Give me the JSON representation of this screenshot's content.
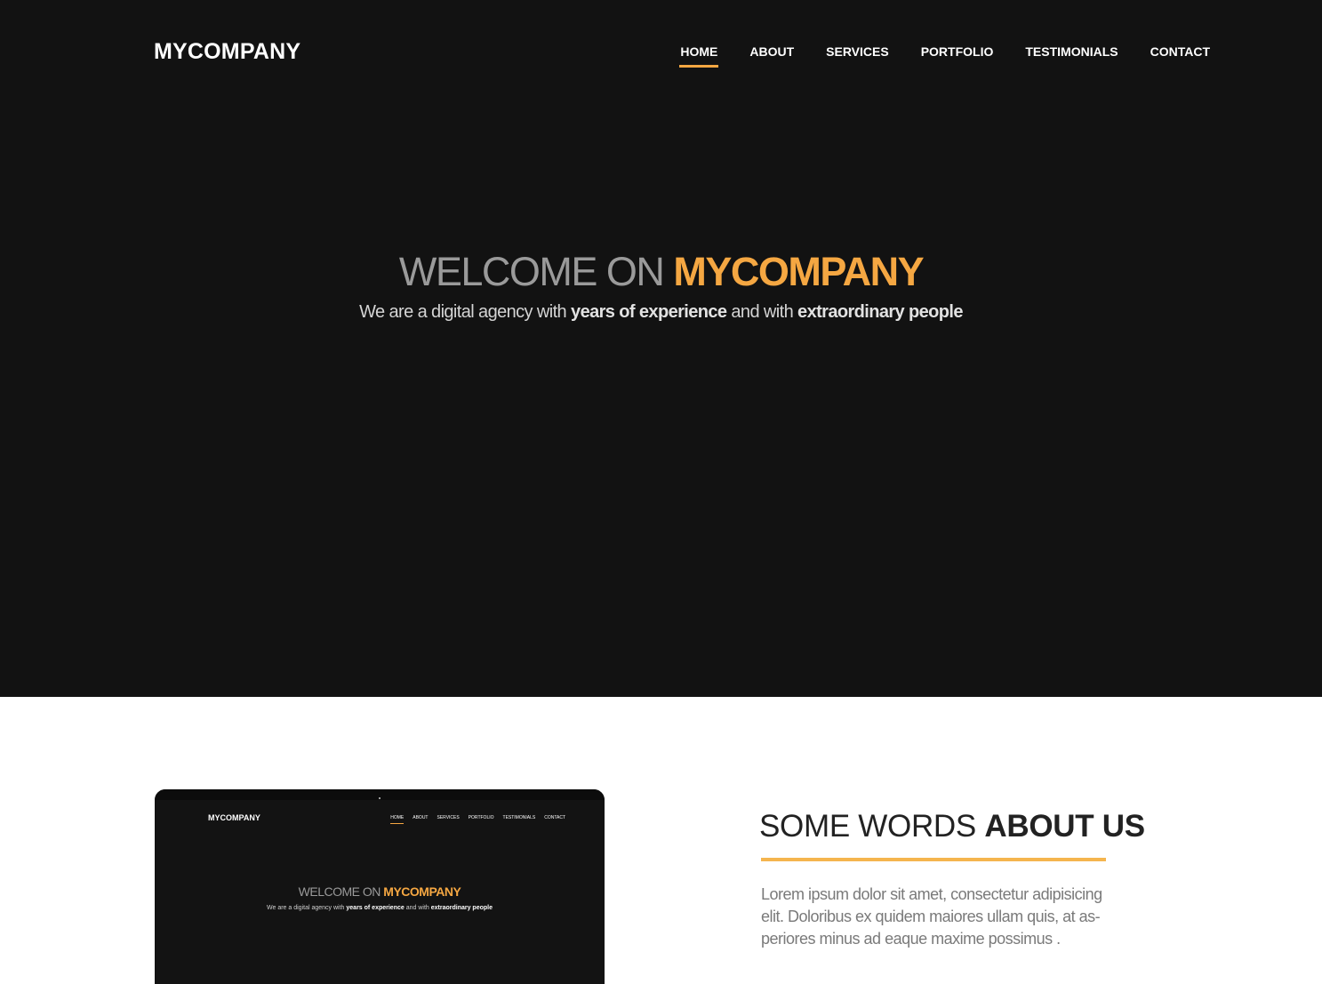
{
  "colors": {
    "hero_background": "#121212",
    "accent": "#f5a742",
    "about_rule": "#f5b54e",
    "white": "#ffffff"
  },
  "header": {
    "brand": "MYCOMPANY",
    "nav": [
      {
        "label": "HOME",
        "active": true
      },
      {
        "label": "ABOUT",
        "active": false
      },
      {
        "label": "SERVICES",
        "active": false
      },
      {
        "label": "PORTFOLIO",
        "active": false
      },
      {
        "label": "TESTIMONIALS",
        "active": false
      },
      {
        "label": "CONTACT",
        "active": false
      }
    ]
  },
  "hero": {
    "title_prefix": "WELCOME ON ",
    "title_accent": "MYCOMPANY",
    "subtitle_part1": "We are a digital agency with ",
    "subtitle_bold1": "years of experience",
    "subtitle_part2": " and with ",
    "subtitle_bold2": "extraordinary people"
  },
  "about": {
    "title_light": "SOME WORDS ",
    "title_bold": "ABOUT US",
    "text": "Lorem ipsum dolor sit amet, consectetur adipisicing elit. Doloribus ex quidem maiores ullam quis, at as-periores minus ad eaque maxime possimus ."
  },
  "mockup": {
    "brand": "MYCOMPANY",
    "nav": [
      "HOME",
      "ABOUT",
      "SERVICES",
      "PORTFOLIO",
      "TESTIMONIALS",
      "CONTACT"
    ],
    "title_prefix": "WELCOME ON ",
    "title_accent": "MYCOMPANY",
    "subtitle_part1": "We are a digital agency with ",
    "subtitle_bold1": "years of experience",
    "subtitle_part2": " and with ",
    "subtitle_bold2": "extraordinary people"
  }
}
